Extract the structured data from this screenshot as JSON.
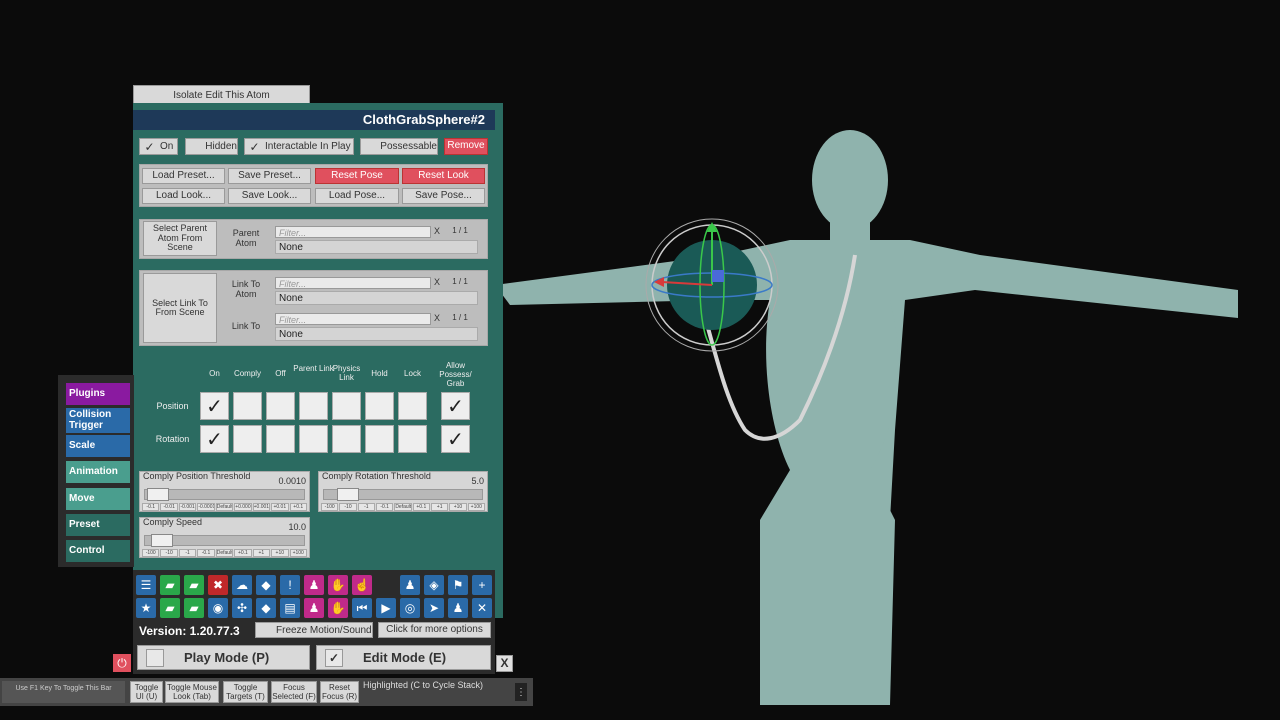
{
  "isolate_button": "Isolate Edit This Atom",
  "atom_title": "ClothGrabSphere#2",
  "toggles": {
    "on": {
      "label": "On",
      "checked": true
    },
    "hidden": {
      "label": "Hidden",
      "checked": false
    },
    "interactable": {
      "label": "Interactable In Play",
      "checked": true
    },
    "possessable": {
      "label": "Possessable",
      "checked": false
    },
    "remove": "Remove"
  },
  "preset_buttons": {
    "load_preset": "Load Preset...",
    "save_preset": "Save Preset...",
    "reset_pose": "Reset Pose",
    "reset_look": "Reset Look",
    "load_look": "Load Look...",
    "save_look": "Save Look...",
    "load_pose": "Load Pose...",
    "save_pose": "Save Pose..."
  },
  "parent": {
    "select_button": "Select Parent Atom From Scene",
    "label": "Parent Atom",
    "filter_placeholder": "Filter...",
    "clear": "X",
    "count": "1 / 1",
    "value": "None"
  },
  "link": {
    "select_button": "Select Link To From Scene",
    "atom_label": "Link To Atom",
    "atom_filter_placeholder": "Filter...",
    "atom_clear": "X",
    "atom_count": "1 / 1",
    "atom_value": "None",
    "link_label": "Link To",
    "link_filter_placeholder": "Filter...",
    "link_clear": "X",
    "link_count": "1 / 1",
    "link_value": "None"
  },
  "state_grid": {
    "columns": [
      "On",
      "Comply",
      "Off",
      "Parent Link",
      "Physics Link",
      "Hold",
      "Lock",
      "Allow Possess/ Grab"
    ],
    "rows": [
      {
        "label": "Position",
        "checked": [
          true,
          false,
          false,
          false,
          false,
          false,
          false,
          true
        ]
      },
      {
        "label": "Rotation",
        "checked": [
          true,
          false,
          false,
          false,
          false,
          false,
          false,
          true
        ]
      }
    ]
  },
  "sliders": {
    "comply_position": {
      "label": "Comply Position Threshold",
      "value": "0.0010",
      "ticks": [
        "-0.1",
        "-0.01",
        "-0.001",
        "-0.0001",
        "Default",
        "+0.0001",
        "+0.001",
        "+0.01",
        "+0.1"
      ]
    },
    "comply_rotation": {
      "label": "Comply Rotation Threshold",
      "value": "5.0",
      "ticks": [
        "-100",
        "-10",
        "-1",
        "-0.1",
        "Default",
        "+0.1",
        "+1",
        "+10",
        "+100"
      ]
    },
    "comply_speed": {
      "label": "Comply Speed",
      "value": "10.0",
      "ticks": [
        "-100",
        "-10",
        "-1",
        "-0.1",
        "Default",
        "+0.1",
        "+1",
        "+10",
        "+100"
      ]
    }
  },
  "side_tabs": [
    {
      "label": "Plugins",
      "color": "#8a1aa0"
    },
    {
      "label": "Collision Trigger",
      "color": "#2a6aa8"
    },
    {
      "label": "Scale",
      "color": "#2a6aa8"
    },
    {
      "label": "Animation",
      "color": "#4a9e8e"
    },
    {
      "label": "Move",
      "color": "#4a9e8e"
    },
    {
      "label": "Preset",
      "color": "#2b6b61"
    },
    {
      "label": "Control",
      "color": "#2b6b61"
    }
  ],
  "toolbar": {
    "row1": [
      {
        "icon": "menu-icon",
        "glyph": "☰",
        "color": "#2a6aa8"
      },
      {
        "icon": "folder-open-icon",
        "glyph": "▰",
        "color": "#2aa84a"
      },
      {
        "icon": "folder-icon",
        "glyph": "▰",
        "color": "#2aa84a"
      },
      {
        "icon": "delete-icon",
        "glyph": "✖",
        "color": "#c0282a"
      },
      {
        "icon": "cloud-icon",
        "glyph": "☁",
        "color": "#2a6aa8"
      },
      {
        "icon": "package-icon",
        "glyph": "◆",
        "color": "#2a6aa8"
      },
      {
        "icon": "info-icon",
        "glyph": "!",
        "color": "#2a6aa8"
      },
      {
        "icon": "person-settings-icon",
        "glyph": "♟",
        "color": "#c02a8a"
      },
      {
        "icon": "hand-icon",
        "glyph": "✋",
        "color": "#c02a8a"
      },
      {
        "icon": "touch-icon",
        "glyph": "☝",
        "color": "#c02a8a"
      },
      {
        "icon": "person-icon",
        "glyph": "♟",
        "color": "#2a6aa8"
      },
      {
        "icon": "unity-icon",
        "glyph": "◈",
        "color": "#2a6aa8"
      },
      {
        "icon": "flag-icon",
        "glyph": "⚑",
        "color": "#2a6aa8"
      },
      {
        "icon": "add-icon",
        "glyph": "+",
        "color": "#2a6aa8"
      }
    ],
    "row2": [
      {
        "icon": "star-icon",
        "glyph": "★",
        "color": "#2a6aa8"
      },
      {
        "icon": "folder-plus-icon",
        "glyph": "▰",
        "color": "#2aa84a"
      },
      {
        "icon": "folder-camera-icon",
        "glyph": "▰",
        "color": "#2aa84a"
      },
      {
        "icon": "camera-icon",
        "glyph": "◉",
        "color": "#2a6aa8"
      },
      {
        "icon": "network-icon",
        "glyph": "✣",
        "color": "#2a6aa8"
      },
      {
        "icon": "package-arrow-icon",
        "glyph": "◆",
        "color": "#2a6aa8"
      },
      {
        "icon": "document-icon",
        "glyph": "▤",
        "color": "#2a6aa8"
      },
      {
        "icon": "person-gear-icon",
        "glyph": "♟",
        "color": "#c02a8a"
      },
      {
        "icon": "hand-gear-icon",
        "glyph": "✋",
        "color": "#c02a8a"
      },
      {
        "icon": "skip-back-icon",
        "glyph": "⏮",
        "color": "#2a6aa8"
      },
      {
        "icon": "play-icon",
        "glyph": "▶",
        "color": "#2a6aa8"
      },
      {
        "icon": "target-icon",
        "glyph": "◎",
        "color": "#2a6aa8"
      },
      {
        "icon": "cursor-icon",
        "glyph": "➤",
        "color": "#2a6aa8"
      },
      {
        "icon": "people-icon",
        "glyph": "♟",
        "color": "#2a6aa8"
      },
      {
        "icon": "tools-icon",
        "glyph": "✕",
        "color": "#2a6aa8"
      }
    ]
  },
  "version_bar": {
    "version": "Version: 1.20.77.3",
    "freeze_label": "Freeze Motion/Sound",
    "more_options": "Click for more options"
  },
  "modes": {
    "play": "Play Mode (P)",
    "edit": "Edit Mode (E)",
    "close": "X"
  },
  "bottom_bar": {
    "f1_hint": "Use F1 Key To Toggle This Bar",
    "toggle_ui": "Toggle UI (U)",
    "toggle_mouse_look": "Toggle Mouse Look (Tab)",
    "toggle_targets": "Toggle Targets (T)",
    "focus_selected": "Focus Selected (F)",
    "reset_focus": "Reset Focus (R)",
    "highlighted": "Highlighted (C to Cycle Stack)"
  }
}
